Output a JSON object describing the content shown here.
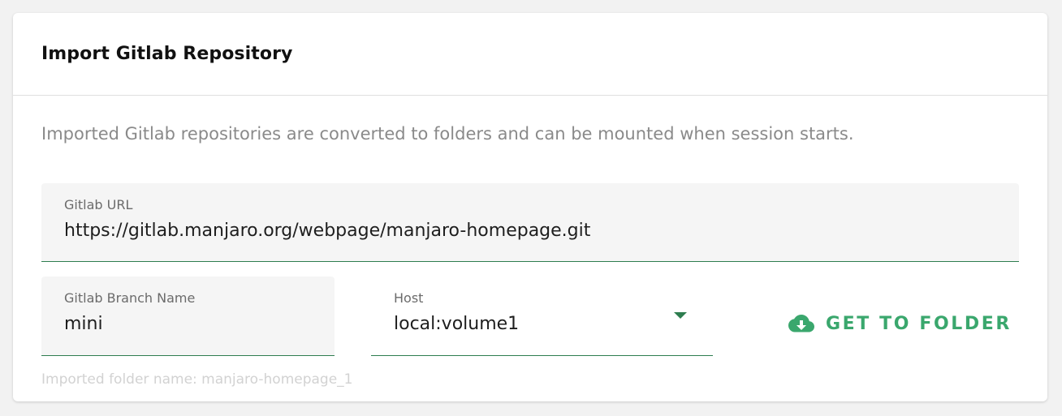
{
  "card": {
    "title": "Import Gitlab Repository",
    "description": "Imported Gitlab repositories are converted to folders and can be mounted when session starts."
  },
  "form": {
    "url": {
      "label": "Gitlab URL",
      "value": "https://gitlab.manjaro.org/webpage/manjaro-homepage.git"
    },
    "branch": {
      "label": "Gitlab Branch Name",
      "value": "mini"
    },
    "host": {
      "label": "Host",
      "value": "local:volume1"
    },
    "get_button_label": "GET TO FOLDER",
    "folder_name_hint": "Imported folder name: manjaro-homepage_1"
  },
  "colors": {
    "accent": "#3aa76d",
    "underline": "#2e7d4f"
  },
  "icons": {
    "get_button": "cloud-download-icon",
    "host_dropdown": "caret-down-icon"
  }
}
